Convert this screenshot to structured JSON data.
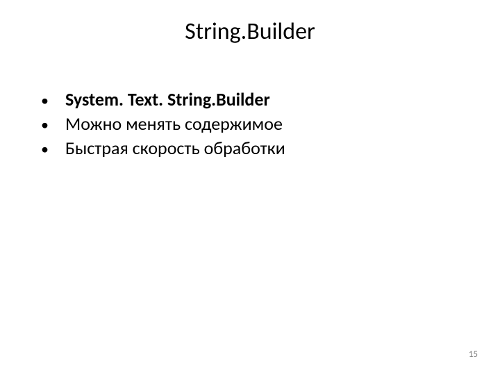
{
  "slide": {
    "title": "String.Builder",
    "bullets": [
      {
        "text": "System. Text. String.Builder",
        "bold": true
      },
      {
        "text": "Можно менять содержимое",
        "bold": false
      },
      {
        "text": "Быстрая скорость обработки",
        "bold": false
      }
    ],
    "page_number": "15"
  }
}
